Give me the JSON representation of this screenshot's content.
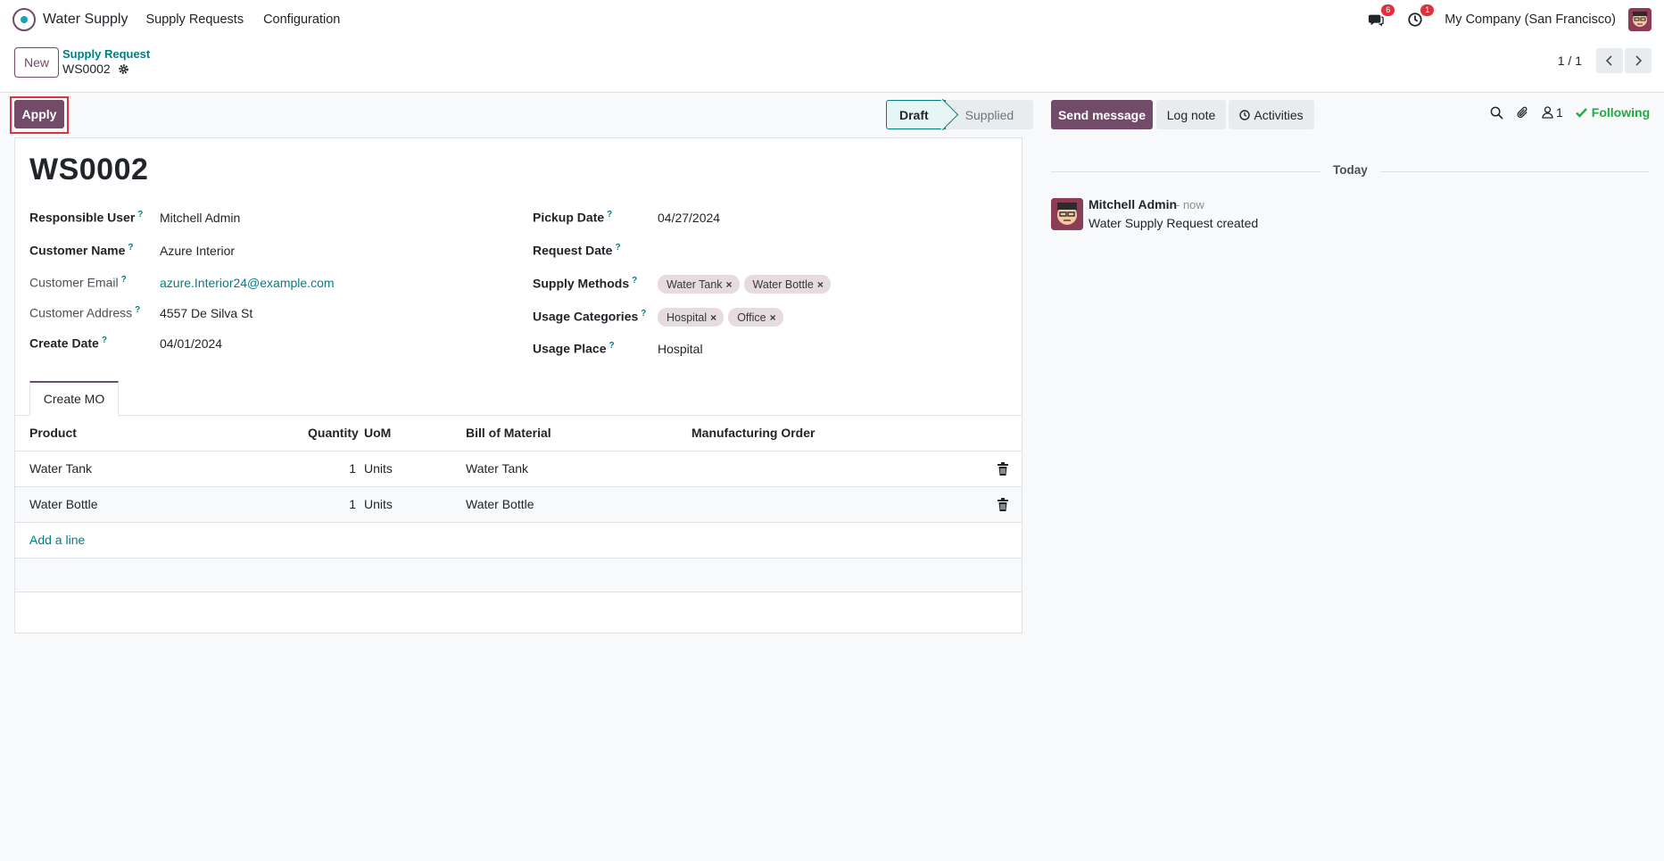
{
  "navbar": {
    "app_name": "Water Supply",
    "menus": [
      "Supply Requests",
      "Configuration"
    ],
    "messages_count": "6",
    "activities_count": "1",
    "company": "My Company (San Francisco)"
  },
  "control": {
    "new_label": "New",
    "breadcrumb_parent": "Supply Request",
    "breadcrumb_current": "WS0002",
    "pager": "1 / 1"
  },
  "statusbar": {
    "apply_label": "Apply",
    "stages": [
      "Draft",
      "Supplied"
    ],
    "active_stage": "Draft"
  },
  "form": {
    "title": "WS0002",
    "left_fields": [
      {
        "label": "Responsible User",
        "value": "Mitchell Admin"
      },
      {
        "label": "Customer Name",
        "value": "Azure Interior"
      },
      {
        "label": "Customer Email",
        "value": "azure.Interior24@example.com"
      },
      {
        "label": "Customer Address",
        "value": "4557 De Silva St"
      },
      {
        "label": "Create Date",
        "value": "04/01/2024"
      }
    ],
    "right_fields": [
      {
        "label": "Pickup Date",
        "value": "04/27/2024"
      },
      {
        "label": "Request Date",
        "value": ""
      },
      {
        "label": "Supply Methods",
        "tags": [
          "Water Tank",
          "Water Bottle"
        ]
      },
      {
        "label": "Usage Categories",
        "tags": [
          "Hospital",
          "Office"
        ]
      },
      {
        "label": "Usage Place",
        "value": "Hospital"
      }
    ],
    "tab_label": "Create MO",
    "table": {
      "headers": [
        "Product",
        "Quantity",
        "UoM",
        "Bill of Material",
        "Manufacturing Order"
      ],
      "rows": [
        {
          "product": "Water Tank",
          "quantity": "1",
          "uom": "Units",
          "bom": "Water Tank",
          "mo": ""
        },
        {
          "product": "Water Bottle",
          "quantity": "1",
          "uom": "Units",
          "bom": "Water Bottle",
          "mo": ""
        }
      ],
      "add_line": "Add a line"
    }
  },
  "chatter": {
    "send_message": "Send message",
    "log_note": "Log note",
    "activities": "Activities",
    "followers_count": "1",
    "following": "Following",
    "date_separator": "Today",
    "message": {
      "author": "Mitchell Admin",
      "time": "- now",
      "body": "Water Supply Request created"
    }
  },
  "colors": {
    "brand": "#714b67",
    "link": "#017e84",
    "following": "#28a745",
    "badge": "#e0303b"
  }
}
